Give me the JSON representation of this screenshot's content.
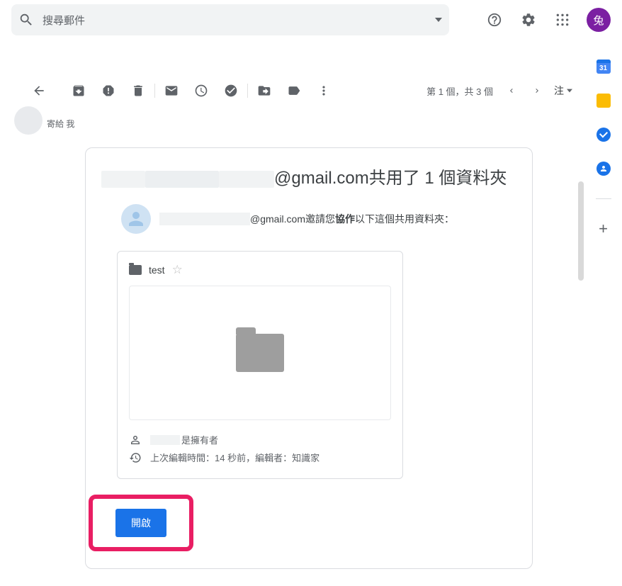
{
  "search": {
    "placeholder": "搜尋郵件"
  },
  "avatar": {
    "letter": "兔"
  },
  "pager": {
    "info": "第 1 個，共 3 個"
  },
  "inputmode": {
    "label": "注"
  },
  "sender_remnant": "寄給 我",
  "email": {
    "title_prefix_redacted": true,
    "title_suffix": "@gmail.com共用了 1 個資料夾",
    "invite_suffix": "@gmail.com邀請您",
    "invite_bold": "協作",
    "invite_tail": "以下這個共用資料夾：",
    "folder_name": "test",
    "owner_suffix": "是擁有者",
    "edit_info": "上次編輯時間：14 秒前，編輯者：知識家",
    "open_button": "開啟"
  },
  "sidepanel": {
    "calendar_day": "31"
  }
}
